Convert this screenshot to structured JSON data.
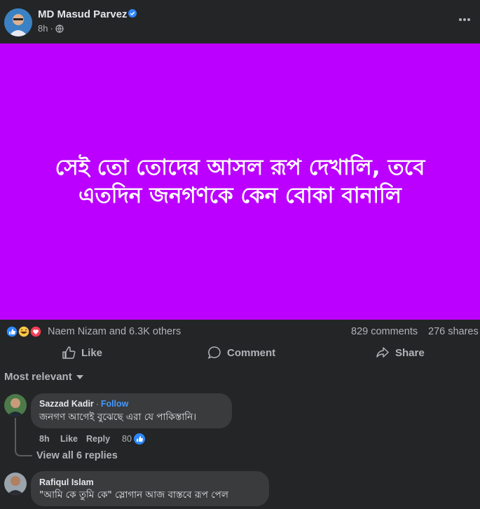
{
  "post": {
    "author": "MD Masud Parvez",
    "time": "8h",
    "separator": "·",
    "image_text": "সেই তো তোদের আসল রূপ দেখালি, তবে\nএতদিন জনগণকে কেন বোকা বানালি",
    "image_bg": "#bb00ff"
  },
  "reactions": {
    "icons": [
      "like-icon",
      "haha-icon",
      "love-icon"
    ],
    "summary": "Naem Nizam and 6.3K others",
    "comments": "829 comments",
    "shares": "276 shares"
  },
  "actions": {
    "like": "Like",
    "comment": "Comment",
    "share": "Share"
  },
  "sort": {
    "label": "Most relevant"
  },
  "comments": [
    {
      "name": "Sazzad Kadir",
      "follow": "Follow",
      "text": "জনগণ আগেই বুঝেছে এরা যে পাকিস্তানি।",
      "time": "8h",
      "like": "Like",
      "reply": "Reply",
      "reaction_count": "80",
      "view_replies": "View all 6 replies"
    },
    {
      "name": "Rafiqul Islam",
      "text": "\"আমি কে তুমি কে\" স্লোগান আজ বাস্তবে রূপ পেল"
    }
  ],
  "colors": {
    "background": "#242526",
    "bubble": "#3a3b3c",
    "link": "#4599ff",
    "verified": "#2d88ff"
  }
}
